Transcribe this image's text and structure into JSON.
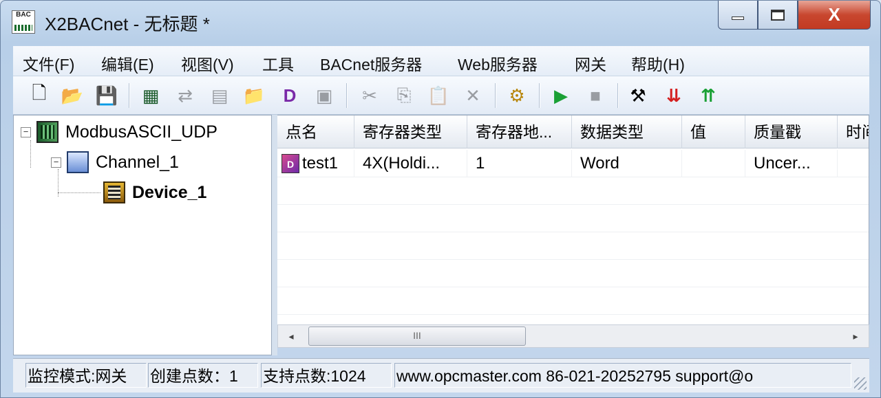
{
  "window": {
    "title": "X2BACnet - 无标题 *",
    "app_icon_text": "BAC",
    "close_glyph": "X"
  },
  "menu": [
    "文件(F)",
    "编辑(E)",
    "视图(V)",
    "工具",
    "BACnet服务器",
    "Web服务器",
    "网关",
    "帮助(H)"
  ],
  "toolbar": [
    {
      "name": "new-icon",
      "glyph": "🗋",
      "enabled": true
    },
    {
      "name": "open-icon",
      "glyph": "📂",
      "enabled": true
    },
    {
      "name": "save-icon",
      "glyph": "💾",
      "enabled": true
    },
    {
      "name": "add-channel-icon",
      "glyph": "▦",
      "enabled": true
    },
    {
      "name": "add-device-icon",
      "glyph": "⇄",
      "enabled": false
    },
    {
      "name": "device-props-icon",
      "glyph": "▤",
      "enabled": false
    },
    {
      "name": "new-folder-icon",
      "glyph": "📁",
      "enabled": true
    },
    {
      "name": "add-point-icon",
      "glyph": "D",
      "enabled": true
    },
    {
      "name": "point-props-icon",
      "glyph": "▣",
      "enabled": false
    },
    {
      "name": "cut-icon",
      "glyph": "✂",
      "enabled": false
    },
    {
      "name": "copy-icon",
      "glyph": "⎘",
      "enabled": false
    },
    {
      "name": "paste-icon",
      "glyph": "📋",
      "enabled": false
    },
    {
      "name": "delete-icon",
      "glyph": "✕",
      "enabled": false
    },
    {
      "name": "monitor-icon",
      "glyph": "⚙",
      "enabled": true
    },
    {
      "name": "run-icon",
      "glyph": "▶",
      "enabled": true
    },
    {
      "name": "stop-icon",
      "glyph": "■",
      "enabled": false
    },
    {
      "name": "tools-icon",
      "glyph": "⚒",
      "enabled": true
    },
    {
      "name": "load-icon",
      "glyph": "⇊",
      "enabled": true
    },
    {
      "name": "upload-icon",
      "glyph": "⇈",
      "enabled": true
    }
  ],
  "tree": {
    "root": "ModbusASCII_UDP",
    "channel": "Channel_1",
    "device": "Device_1"
  },
  "grid": {
    "columns": [
      "点名",
      "寄存器类型",
      "寄存器地...",
      "数据类型",
      "值",
      "质量戳",
      "时间"
    ],
    "rows": [
      {
        "icon": "D",
        "name": "test1",
        "register_type": "4X(Holdi...",
        "address": "1",
        "data_type": "Word",
        "value": "",
        "quality": "Uncer...",
        "time": ""
      }
    ]
  },
  "scrollbar": {
    "left_arrow": "◂",
    "right_arrow": "▸",
    "thumb_grip": "III"
  },
  "status": {
    "mode": "监控模式:网关",
    "created": "创建点数：1",
    "supported": "支持点数:1024",
    "contact": "www.opcmaster.com 86-021-20252795 support@o"
  },
  "colors": {
    "close_button": "#c8472f",
    "run_icon": "#1aa035",
    "stop_icon": "#555555"
  }
}
